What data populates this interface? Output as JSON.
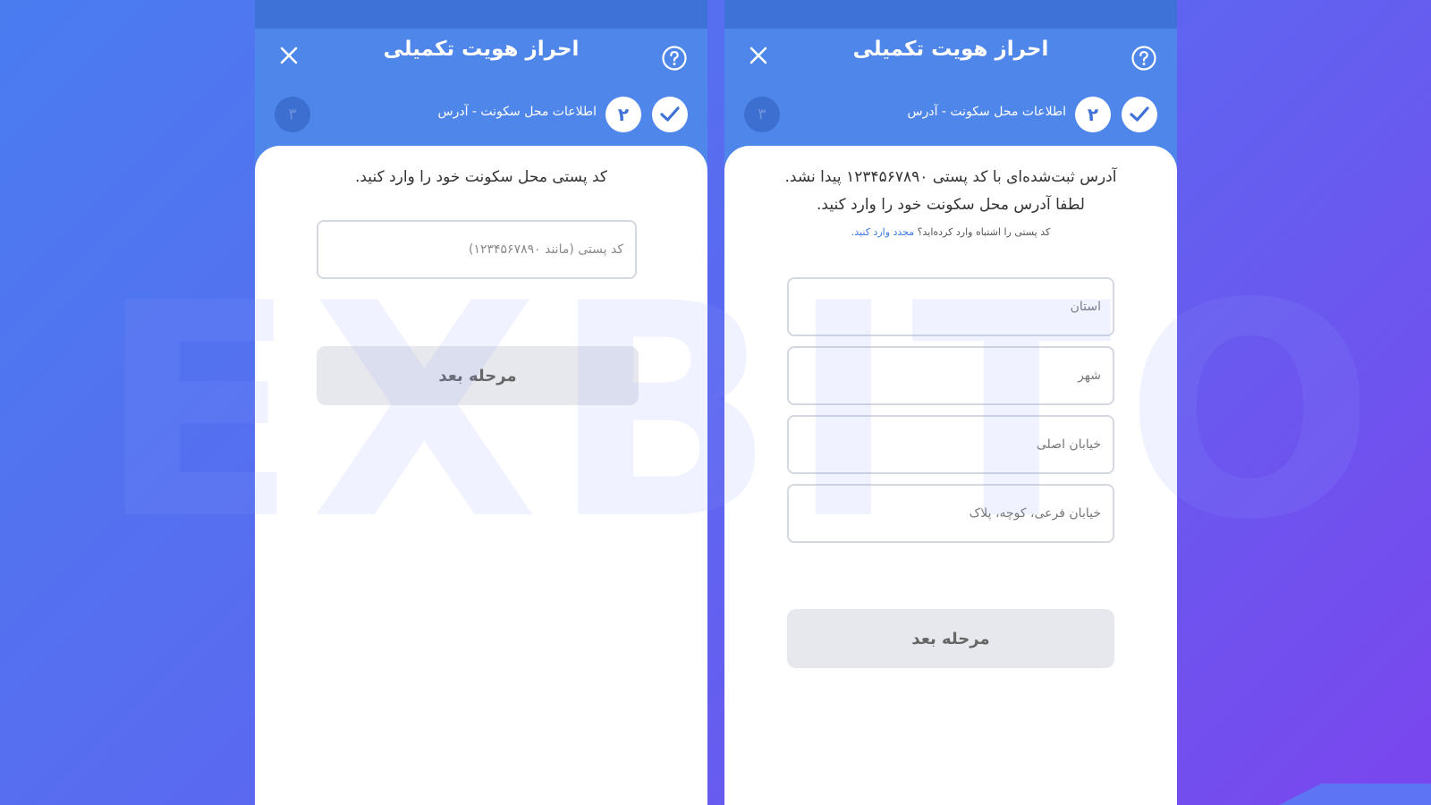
{
  "colors": {
    "brand_blue": "#4f86ea",
    "header_dark": "#3f72d6",
    "background_start": "#4a7cf0",
    "background_end": "#7a46ee",
    "link_blue": "#3a78e8",
    "button_disabled": "#e7e8ed"
  },
  "left_screen": {
    "title": "احراز هویت تکمیلی",
    "step_current": "۲",
    "step_label": "اطلاعات محل سکونت - آدرس",
    "step_next": "۳",
    "instruction": "کد پستی محل سکونت خود را وارد کنید.",
    "postal_placeholder": "کد پستی (مانند ۱۲۳۴۵۶۷۸۹۰)",
    "next_button": "مرحله بعد"
  },
  "right_screen": {
    "title": "احراز هویت تکمیلی",
    "step_current": "۲",
    "step_label": "اطلاعات محل سکونت - آدرس",
    "step_next": "۳",
    "instruction_line1": "آدرس ثبت‌شده‌ای با کد پستی ۱۲۳۴۵۶۷۸۹۰ پیدا نشد.",
    "instruction_line2": "لطفا آدرس محل سکونت خود را وارد کنید.",
    "hint_text": "کد پستی را اشتباه وارد کرده‌اید؟",
    "hint_link": "مجدد وارد کنید.",
    "fields": {
      "province": "استان",
      "city": "شهر",
      "main_street": "خیابان اصلی",
      "side_street": "خیابان فرعی، کوچه، پلاک"
    },
    "next_button": "مرحله بعد"
  },
  "watermark": {
    "text": "EXBITO"
  },
  "icons": [
    "close-icon",
    "help-icon",
    "checkmark-icon"
  ]
}
